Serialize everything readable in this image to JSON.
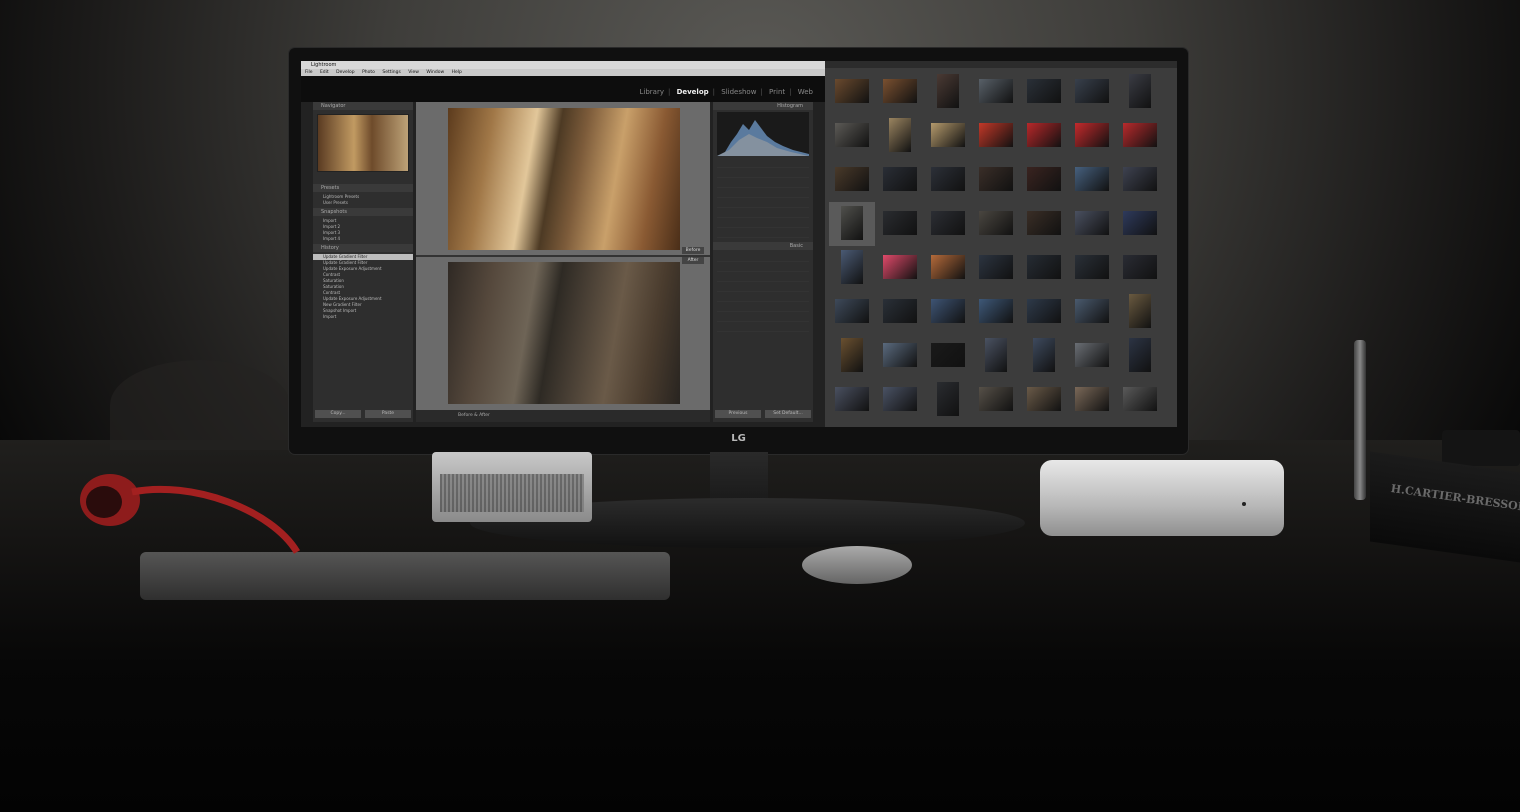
{
  "app": {
    "title": "Lightroom",
    "menu": [
      "File",
      "Edit",
      "Develop",
      "Photo",
      "Settings",
      "View",
      "Window",
      "Help"
    ],
    "modules": [
      "Library",
      "Develop",
      "Slideshow",
      "Print",
      "Web"
    ],
    "active_module": "Develop"
  },
  "left_panel": {
    "navigator_label": "Navigator",
    "presets_label": "Presets",
    "presets": [
      "Lightroom Presets",
      "User Presets"
    ],
    "snapshots_label": "Snapshots",
    "snapshots": [
      "Import",
      "Import 2",
      "Import 3",
      "Import 4"
    ],
    "history_label": "History",
    "history": [
      "Update Gradient Filter",
      "Update Gradient Filter",
      "Update Exposure Adjustment",
      "Contrast",
      "Saturation",
      "Saturation",
      "Contrast",
      "Update Exposure Adjustment",
      "New Gradient Filter",
      "Snapshot Import",
      "Import"
    ],
    "copy_button": "Copy...",
    "paste_button": "Paste"
  },
  "center": {
    "before_label": "Before",
    "after_label": "After",
    "toolbar_label": "Before & After"
  },
  "right_panel": {
    "histogram_label": "Histogram",
    "basic_label": "Basic",
    "previous_button": "Previous",
    "reset_button": "Set Default..."
  },
  "device": {
    "brand": "LG"
  },
  "desk": {
    "book_title": "H.CARTIER-BRESSON PHOTO"
  },
  "thumbnails": [
    "#6a4a2e",
    "#7a5030",
    "#4a3a34",
    "#586068",
    "#2a3038",
    "#38404c",
    "#3a3c44",
    "#5c5a56",
    "#9a8460",
    "#b49a6c",
    "#c23828",
    "#b8282a",
    "#c42a2c",
    "#b82a2c",
    "#4a3a2a",
    "#2a2e36",
    "#2c3038",
    "#3a2e28",
    "#3a2420",
    "#46607e",
    "#3e4250",
    "#50504c",
    "#2a2c30",
    "#2c2e34",
    "#4a4640",
    "#3a2e26",
    "#4a5060",
    "#2e3a5c",
    "#4a5a74",
    "#e04a6a",
    "#b46a3a",
    "#2c3440",
    "#262c34",
    "#2a3038",
    "#2a2c34",
    "#3e4a5a",
    "#2a3038",
    "#3e5474",
    "#3e5878",
    "#2e3a4a",
    "#4a5a6e",
    "#6a5a40",
    "#6a5030",
    "#5a6a7e",
    "#1a1a1a",
    "#4a5262",
    "#3e4a5e",
    "#6a6e74",
    "#2c3444",
    "#4a5060",
    "#4a5264",
    "#2a2c30",
    "#565048",
    "#6a5a48",
    "#7a6858",
    "#5a5a5a"
  ]
}
